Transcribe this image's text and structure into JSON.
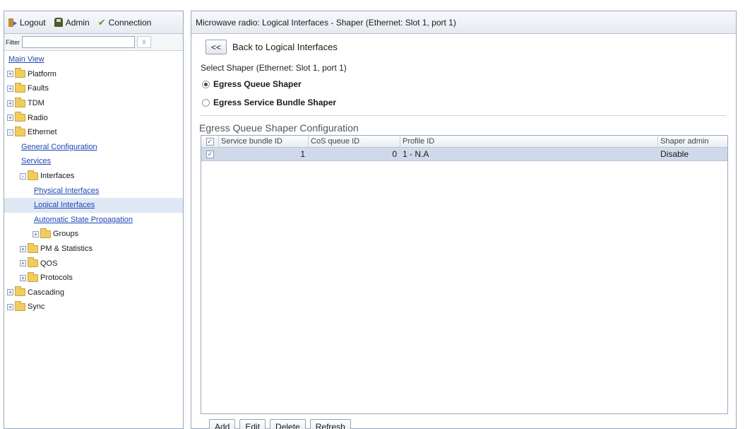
{
  "nav_top": {
    "logout": "Logout",
    "admin": "Admin",
    "connection": "Connection"
  },
  "filter": {
    "label": "Filter",
    "value": "",
    "clear": "x"
  },
  "tree": [
    {
      "label": "Main View",
      "link": true,
      "indent": 0,
      "expander": "",
      "folder": false
    },
    {
      "label": "Platform",
      "link": false,
      "indent": 0,
      "expander": "+",
      "folder": true
    },
    {
      "label": "Faults",
      "link": false,
      "indent": 0,
      "expander": "+",
      "folder": true
    },
    {
      "label": "TDM",
      "link": false,
      "indent": 0,
      "expander": "+",
      "folder": true
    },
    {
      "label": "Radio",
      "link": false,
      "indent": 0,
      "expander": "+",
      "folder": true
    },
    {
      "label": "Ethernet",
      "link": false,
      "indent": 0,
      "expander": "-",
      "folder": true
    },
    {
      "label": "General Configuration",
      "link": true,
      "indent": 1,
      "expander": "",
      "folder": false
    },
    {
      "label": "Services",
      "link": true,
      "indent": 1,
      "expander": "",
      "folder": false
    },
    {
      "label": "Interfaces",
      "link": false,
      "indent": 1,
      "expander": "-",
      "folder": true
    },
    {
      "label": "Physical Interfaces",
      "link": true,
      "indent": 2,
      "expander": "",
      "folder": false
    },
    {
      "label": "Logical Interfaces",
      "link": true,
      "indent": 2,
      "expander": "",
      "folder": false,
      "selected": true
    },
    {
      "label": "Automatic State Propagation",
      "link": true,
      "indent": 2,
      "expander": "",
      "folder": false
    },
    {
      "label": "Groups",
      "link": false,
      "indent": 2,
      "expander": "+",
      "folder": true
    },
    {
      "label": "PM & Statistics",
      "link": false,
      "indent": 1,
      "expander": "+",
      "folder": true
    },
    {
      "label": "QOS",
      "link": false,
      "indent": 1,
      "expander": "+",
      "folder": true
    },
    {
      "label": "Protocols",
      "link": false,
      "indent": 1,
      "expander": "+",
      "folder": true
    },
    {
      "label": "Cascading",
      "link": false,
      "indent": 0,
      "expander": "+",
      "folder": true
    },
    {
      "label": "Sync",
      "link": false,
      "indent": 0,
      "expander": "+",
      "folder": true
    }
  ],
  "page": {
    "title": "Microwave radio: Logical Interfaces - Shaper (Ethernet: Slot 1, port 1)",
    "back_button": "<<",
    "back_label": "Back to Logical Interfaces",
    "select_label": "Select Shaper (Ethernet: Slot 1, port 1)",
    "radio_options": [
      {
        "label": "Egress Queue Shaper",
        "checked": true
      },
      {
        "label": "Egress Service Bundle Shaper",
        "checked": false
      }
    ],
    "section_title": "Egress Queue Shaper Configuration"
  },
  "table": {
    "columns": [
      "Service bundle ID",
      "CoS queue ID",
      "Profile ID",
      "Shaper admin"
    ],
    "rows": [
      {
        "service_bundle_id": "1",
        "cos_queue_id": "0",
        "profile_id": "1 - N.A",
        "shaper_admin": "Disable"
      }
    ]
  },
  "actions": [
    "Add",
    "Edit",
    "Delete",
    "Refresh"
  ]
}
